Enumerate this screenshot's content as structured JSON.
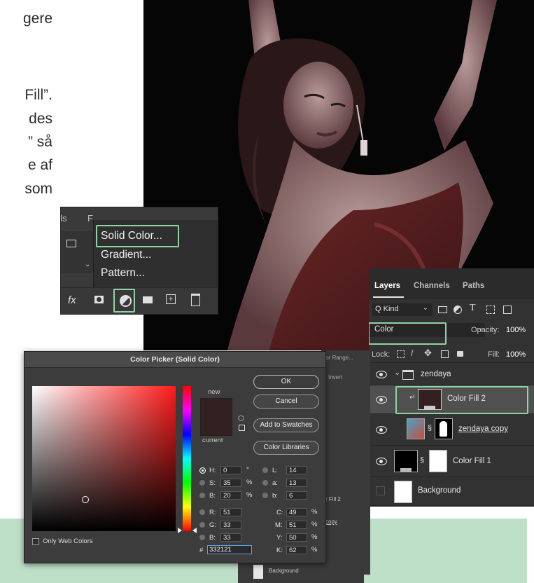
{
  "article": {
    "lines": [
      "gere",
      "Fill”.",
      "des",
      "” så",
      "e af",
      "som"
    ]
  },
  "fill_menu": {
    "top_tabs": [
      "els",
      "F"
    ],
    "items": [
      "Solid Color...",
      "Gradient...",
      "Pattern..."
    ],
    "bottom_icons": [
      "fx-icon",
      "mask-icon",
      "adjustment-layer-icon",
      "folder-icon",
      "new-layer-icon",
      "trash-icon"
    ],
    "fx_label": "fx",
    "highlight_color": "#8fd3a0"
  },
  "layers": {
    "tabs": [
      "Layers",
      "Channels",
      "Paths"
    ],
    "kind_label": "Q Kind",
    "blend_mode": "Color",
    "opacity_label": "Opacity:",
    "opacity_value": "100%",
    "lock_label": "Lock:",
    "fill_label": "Fill:",
    "fill_value": "100%",
    "items": [
      {
        "name": "zendaya"
      },
      {
        "name": "Color Fill 2"
      },
      {
        "name": "zendaya copy"
      },
      {
        "name": "Color Fill 1"
      },
      {
        "name": "Background"
      }
    ]
  },
  "color_picker": {
    "title": "Color Picker (Solid Color)",
    "new_label": "new",
    "current_label": "current",
    "buttons": [
      "OK",
      "Cancel",
      "Add to Swatches",
      "Color Libraries"
    ],
    "hsb": [
      {
        "label": "H:",
        "value": "0",
        "unit": "°"
      },
      {
        "label": "S:",
        "value": "35",
        "unit": "%"
      },
      {
        "label": "B:",
        "value": "20",
        "unit": "%"
      }
    ],
    "rgb": [
      {
        "label": "R:",
        "value": "51"
      },
      {
        "label": "G:",
        "value": "33"
      },
      {
        "label": "B:",
        "value": "33"
      }
    ],
    "lab": [
      {
        "label": "L:",
        "value": "14"
      },
      {
        "label": "a:",
        "value": "13"
      },
      {
        "label": "b:",
        "value": "6"
      }
    ],
    "cmyk": [
      {
        "label": "C:",
        "value": "49",
        "unit": "%"
      },
      {
        "label": "M:",
        "value": "51",
        "unit": "%"
      },
      {
        "label": "Y:",
        "value": "50",
        "unit": "%"
      },
      {
        "label": "K:",
        "value": "62",
        "unit": "%"
      }
    ],
    "hex_label": "#",
    "hex_value": "332121",
    "only_web_colors": "Only Web Colors",
    "swatch_color": "#332121"
  },
  "background_panel": {
    "labels": [
      "olor Range...",
      "Invert",
      "r Fill 2",
      "copy",
      "Background"
    ]
  },
  "colors": {
    "accent_green": "#8fd3a0",
    "band_green": "#bfe0c8",
    "panel_dark": "#323232"
  }
}
